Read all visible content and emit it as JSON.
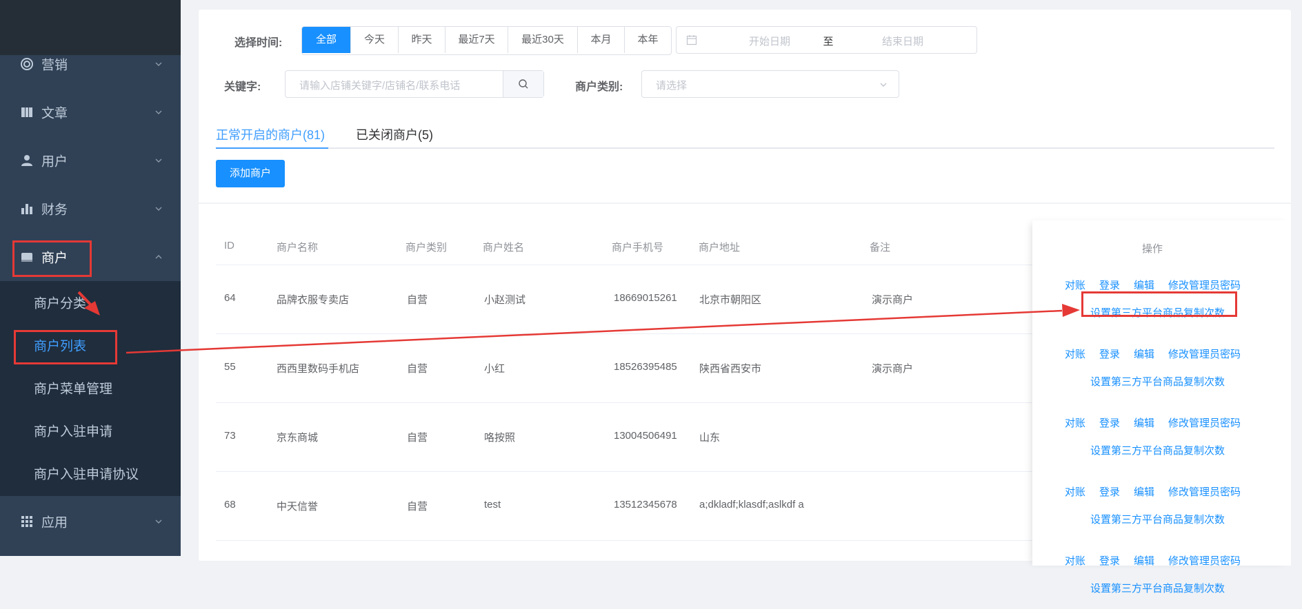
{
  "sidebar": {
    "items": [
      {
        "label": "营销",
        "icon": "target-icon",
        "name": "sidebar-item-marketing",
        "expanded": false
      },
      {
        "label": "文章",
        "icon": "book-icon",
        "name": "sidebar-item-articles",
        "expanded": false
      },
      {
        "label": "用户",
        "icon": "user-icon",
        "name": "sidebar-item-users",
        "expanded": false
      },
      {
        "label": "财务",
        "icon": "bar-chart-icon",
        "name": "sidebar-item-finance",
        "expanded": false
      },
      {
        "label": "商户",
        "icon": "store-icon",
        "name": "sidebar-item-merchants",
        "expanded": true
      },
      {
        "label": "应用",
        "icon": "grid-icon",
        "name": "sidebar-item-apps",
        "expanded": false
      }
    ],
    "submenu": [
      {
        "label": "商户分类",
        "active": false
      },
      {
        "label": "商户列表",
        "active": true
      },
      {
        "label": "商户菜单管理",
        "active": false
      },
      {
        "label": "商户入驻申请",
        "active": false
      },
      {
        "label": "商户入驻申请协议",
        "active": false
      }
    ]
  },
  "filters": {
    "time_label": "选择时间:",
    "time_options": [
      "全部",
      "今天",
      "昨天",
      "最近7天",
      "最近30天",
      "本月",
      "本年"
    ],
    "time_selected": "全部",
    "date_start_placeholder": "开始日期",
    "date_separator": "至",
    "date_end_placeholder": "结束日期",
    "keyword_label": "关键字:",
    "keyword_placeholder": "请输入店铺关键字/店铺名/联系电话",
    "category_label": "商户类别:",
    "category_placeholder": "请选择"
  },
  "tabs": [
    {
      "label": "正常开启的商户(81)",
      "active": true
    },
    {
      "label": "已关闭商户(5)",
      "active": false
    }
  ],
  "add_button": "添加商户",
  "table": {
    "columns": [
      "ID",
      "商户名称",
      "商户类别",
      "商户姓名",
      "商户手机号",
      "商户地址",
      "备注",
      "操作"
    ],
    "rows": [
      {
        "id": "64",
        "name": "品牌衣服专卖店",
        "category": "自营",
        "contact": "小赵测试",
        "phone": "18669015261",
        "address": "北京市朝阳区",
        "note": "演示商户"
      },
      {
        "id": "55",
        "name": "西西里数码手机店",
        "category": "自营",
        "contact": "小红",
        "phone": "18526395485",
        "address": "陕西省西安市",
        "note": "演示商户"
      },
      {
        "id": "73",
        "name": "京东商城",
        "category": "自营",
        "contact": "咯按照",
        "phone": "13004506491",
        "address": "山东",
        "note": ""
      },
      {
        "id": "68",
        "name": "中天信誉",
        "category": "自营",
        "contact": "test",
        "phone": "13512345678",
        "address": "a;dkladf;klasdf;aslkdf a",
        "note": ""
      }
    ],
    "actions": {
      "reconcile": "对账",
      "login": "登录",
      "edit": "编辑",
      "change_password": "修改管理员密码",
      "set_copy_count": "设置第三方平台商品复制次数"
    }
  },
  "annotation_color": "#e53935",
  "accent_color": "#1890ff"
}
